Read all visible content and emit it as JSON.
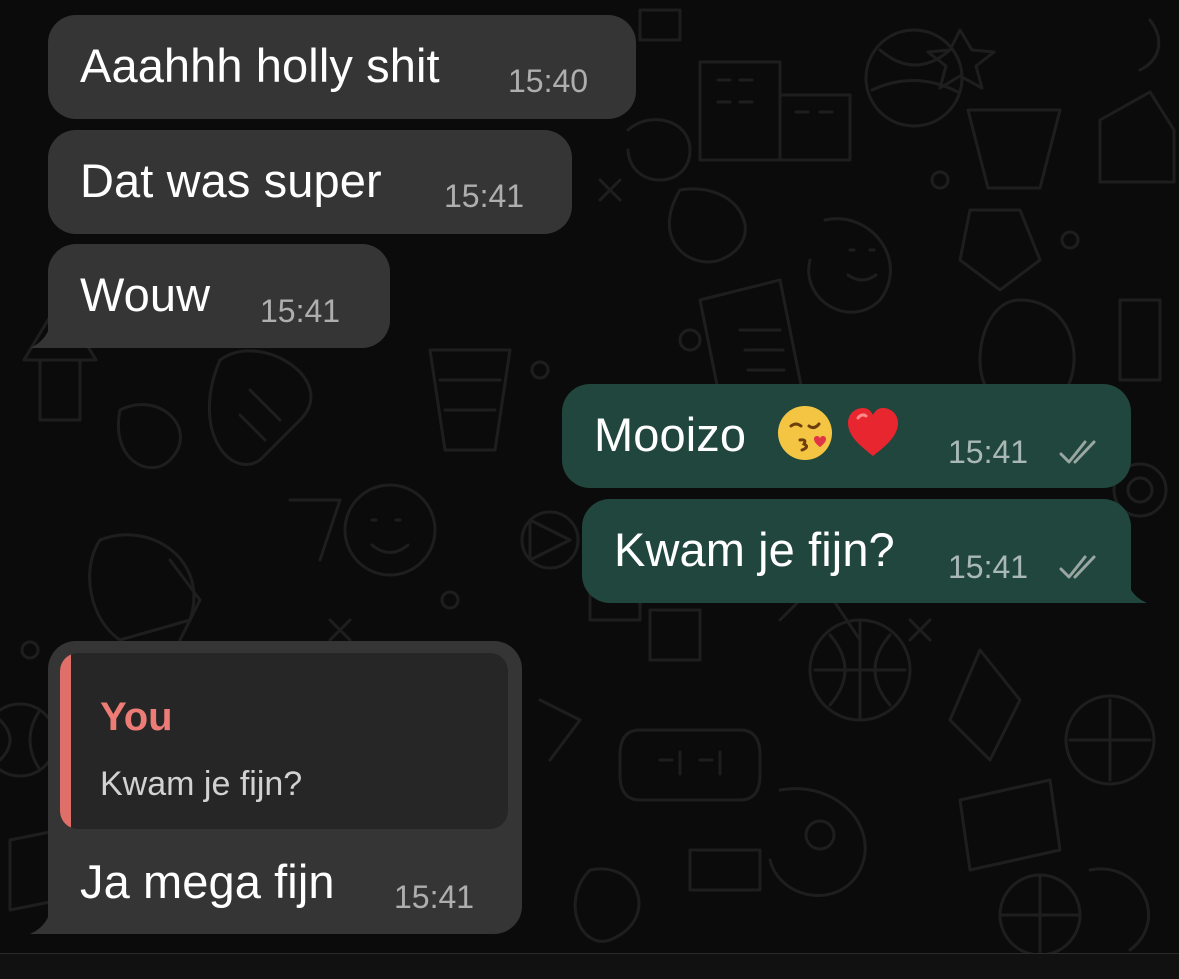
{
  "messages": [
    {
      "text": "Aaahhh holly shit",
      "time": "15:40"
    },
    {
      "text": "Dat was super",
      "time": "15:41"
    },
    {
      "text": "Wouw",
      "time": "15:41"
    },
    {
      "text": "Mooizo",
      "time": "15:41",
      "emojis": [
        "kiss-face",
        "red-heart"
      ],
      "status": "read"
    },
    {
      "text": "Kwam je fijn?",
      "time": "15:41",
      "status": "read"
    },
    {
      "reply_author": "You",
      "reply_text": "Kwam je fijn?",
      "text": "Ja mega fijn",
      "time": "15:41"
    }
  ],
  "colors": {
    "background": "#0b0b0b",
    "incoming_bubble": "#353535",
    "outgoing_bubble": "#20463d",
    "reply_accent": "#e06f6a",
    "reply_author": "#ec7c75"
  }
}
